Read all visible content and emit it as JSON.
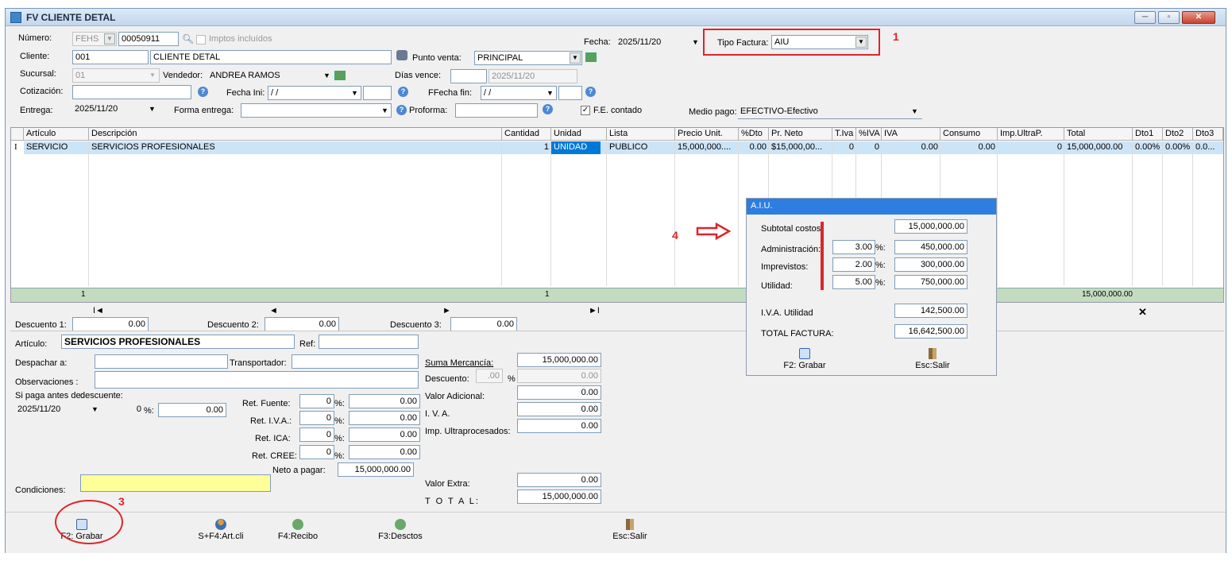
{
  "window": {
    "title": "FV CLIENTE DETAL",
    "min": "─",
    "max": "▫",
    "close": "✕"
  },
  "header": {
    "numero_label": "Número:",
    "numero_prefix": "FEHS",
    "numero_value": "00050911",
    "imptos_label": "Imptos incluídos",
    "fecha_label": "Fecha:",
    "fecha_value": "2025/11/20",
    "tipo_factura_label": "Tipo Factura:",
    "tipo_factura_value": "AIU",
    "cliente_label": "Cliente:",
    "cliente_code": "001",
    "cliente_name": "CLIENTE DETAL",
    "punto_venta_label": "Punto venta:",
    "punto_venta_value": "PRINCIPAL",
    "sucursal_label": "Sucursal:",
    "sucursal_value": "01",
    "vendedor_label": "Vendedor:",
    "vendedor_value": "ANDREA RAMOS",
    "dias_vence_label": "Días vence:",
    "dias_vence_date": "2025/11/20",
    "cotizacion_label": "Cotización:",
    "fecha_ini_label": "Fecha Ini:",
    "fecha_ini_value": "/ /",
    "ffecha_fin_label": "FFecha fin:",
    "ffecha_fin_value": "/ /",
    "entrega_label": "Entrega:",
    "entrega_value": "2025/11/20",
    "forma_entrega_label": "Forma entrega:",
    "proforma_label": "Proforma:",
    "fe_contado_label": "F.E. contado",
    "medio_pago_label": "Medio pago:",
    "medio_pago_value": "EFECTIVO-Efectivo"
  },
  "grid": {
    "columns": [
      "Artículo",
      "Descripción",
      "Cantidad",
      "Unidad",
      "Lista",
      "Precio Unit.",
      "%Dto",
      "Pr. Neto",
      "T.Iva",
      "%IVA",
      "IVA",
      "Consumo",
      "Imp.UltraP.",
      "Total",
      "Dto1",
      "Dto2",
      "Dto3"
    ],
    "row": {
      "cursor": "I",
      "articulo": "SERVICIO",
      "descripcion": "SERVICIOS PROFESIONALES",
      "cantidad": "1",
      "unidad": "UNIDAD",
      "lista": "PUBLICO",
      "precio": "15,000,000....",
      "dto": "0.00",
      "pr_neto": "$15,000,00...",
      "t_iva": "0",
      "pct_iva": "0",
      "iva": "0.00",
      "consumo": "0.00",
      "imp_ultra": "0",
      "total": "15,000,000.00",
      "dto1": "0.00%",
      "dto2": "0.00%",
      "dto3": "0.0..."
    },
    "totals": {
      "count": "1",
      "cantidad": "1",
      "total": "15,000,000.00"
    },
    "nav": {
      "first": "I◄",
      "prev": "◄",
      "next": "►",
      "last": "►I",
      "delete": "✕"
    }
  },
  "descuentos": {
    "d1_label": "Descuento 1:",
    "d1": "0.00",
    "d2_label": "Descuento 2:",
    "d2": "0.00",
    "d3_label": "Descuento 3:",
    "d3": "0.00"
  },
  "detail": {
    "articulo_label": "Artículo:",
    "articulo_value": "SERVICIOS PROFESIONALES",
    "ref_label": "Ref:",
    "despachar_label": "Despachar a:",
    "transportador_label": "Transportador:",
    "observaciones_label": "Observaciones :",
    "si_paga_label": "Si paga antes de:",
    "descuente_label": "descuente:",
    "si_paga_date": "2025/11/20",
    "descuente_pct": "0",
    "descuente_pct_sym": "%:",
    "descuente_val": "0.00",
    "ret_fuente_label": "Ret. Fuente:",
    "ret_iva_label": "Ret. I.V.A.:",
    "ret_ica_label": "Ret. ICA:",
    "ret_cree_label": "Ret. CREE:",
    "ret_pct": "0",
    "pct_sym": "%:",
    "ret_val": "0.00",
    "neto_label": "Neto a pagar:",
    "neto_value": "15,000,000.00",
    "condiciones_label": "Condiciones:"
  },
  "summary": {
    "suma_label": "Suma Mercancía:",
    "suma_value": "15,000,000.00",
    "descuento_label": "Descuento:",
    "descuento_pct": ".00",
    "descuento_pct_sym": "%",
    "descuento_value": "0.00",
    "valor_adicional_label": "Valor Adicional:",
    "valor_adicional": "0.00",
    "iva_label": "I. V. A.",
    "iva": "0.00",
    "imp_ultra_label": "Imp. Ultraprocesados:",
    "imp_ultra": "0.00",
    "valor_extra_label": "Valor Extra:",
    "valor_extra": "0.00",
    "total_label": "T O T A L:",
    "total": "15,000,000.00"
  },
  "aiu": {
    "title": "A.I.U.",
    "subtotal_label": "Subtotal costos:",
    "subtotal": "15,000,000.00",
    "admin_label": "Administración:",
    "admin_pct": "3.00",
    "admin_val": "450,000.00",
    "imprev_label": "Imprevistos:",
    "imprev_pct": "2.00",
    "imprev_val": "300,000.00",
    "util_label": "Utilidad:",
    "util_pct": "5.00",
    "util_val": "750,000.00",
    "pct_sym": "%:",
    "iva_util_label": "I.V.A. Utilidad",
    "iva_util": "142,500.00",
    "total_label": "TOTAL FACTURA:",
    "total": "16,642,500.00",
    "grabar": "F2: Grabar",
    "salir": "Esc:Salir"
  },
  "toolbar": {
    "grabar": "F2: Grabar",
    "artcli": "S+F4:Art.cli",
    "recibo": "F4:Recibo",
    "desctos": "F3:Desctos",
    "salir": "Esc:Salir"
  },
  "annotations": {
    "n1": "1",
    "n3": "3",
    "n4": "4"
  },
  "colors": {
    "selection": "#0078d7",
    "totals_row": "#c3dcc0",
    "annotation": "#e0232a",
    "aiu_title": "#2d7ee0",
    "condiciones": "#ffff99"
  }
}
